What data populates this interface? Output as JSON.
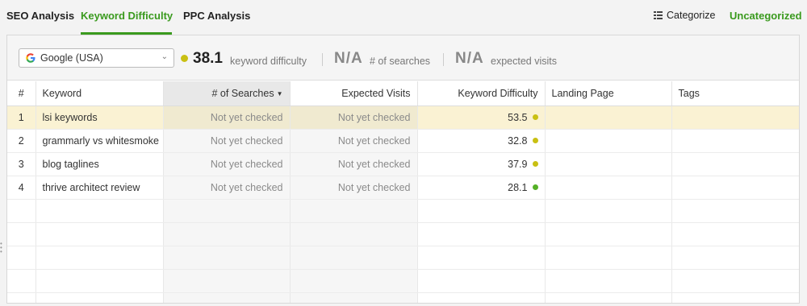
{
  "tabs": [
    {
      "label": "SEO Analysis",
      "active": false
    },
    {
      "label": "Keyword Difficulty",
      "active": true
    },
    {
      "label": "PPC Analysis",
      "active": false
    }
  ],
  "toolbar": {
    "categorize_label": "Categorize",
    "uncategorized_label": "Uncategorized"
  },
  "filter": {
    "search_engine": "Google (USA)",
    "difficulty_value": "38.1",
    "difficulty_label": "keyword difficulty",
    "searches_value": "N/A",
    "searches_label": "# of searches",
    "visits_value": "N/A",
    "visits_label": "expected visits"
  },
  "table": {
    "columns": [
      "#",
      "Keyword",
      "# of Searches",
      "Expected Visits",
      "Keyword Difficulty",
      "Landing Page",
      "Tags"
    ],
    "rows": [
      {
        "num": "1",
        "keyword": "lsi keywords",
        "searches": "Not yet checked",
        "visits": "Not yet checked",
        "difficulty": "53.5",
        "dot_color": "#c9c013",
        "landing": "",
        "tags": ""
      },
      {
        "num": "2",
        "keyword": "grammarly vs whitesmoke",
        "searches": "Not yet checked",
        "visits": "Not yet checked",
        "difficulty": "32.8",
        "dot_color": "#c9c013",
        "landing": "",
        "tags": ""
      },
      {
        "num": "3",
        "keyword": "blog taglines",
        "searches": "Not yet checked",
        "visits": "Not yet checked",
        "difficulty": "37.9",
        "dot_color": "#c9c013",
        "landing": "",
        "tags": ""
      },
      {
        "num": "4",
        "keyword": "thrive architect review",
        "searches": "Not yet checked",
        "visits": "Not yet checked",
        "difficulty": "28.1",
        "dot_color": "#55b026",
        "landing": "",
        "tags": ""
      }
    ]
  },
  "colors": {
    "accent": "#3a9a1e",
    "medium_difficulty": "#c9c013",
    "easy_difficulty": "#55b026",
    "selected_row": "#faf2d3"
  }
}
